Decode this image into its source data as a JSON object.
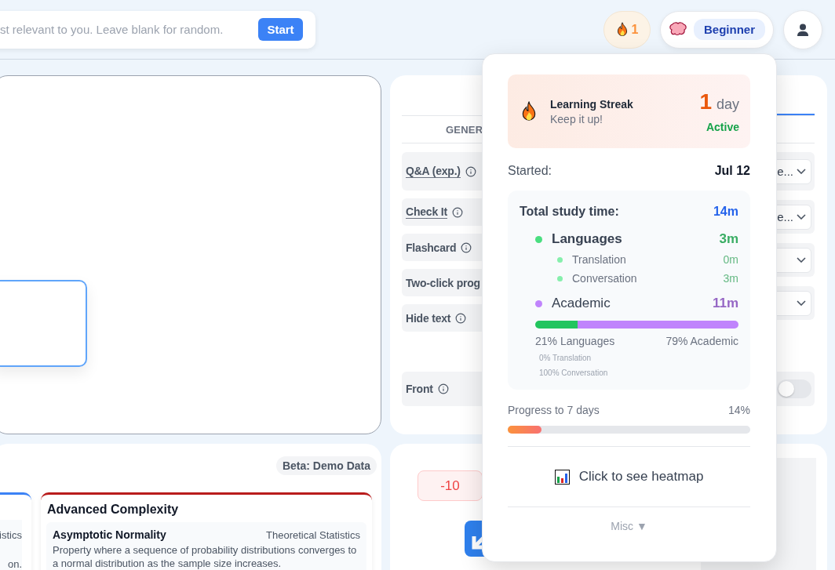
{
  "search": {
    "placeholder": "st relevant to you. Leave blank for random.",
    "button": "Start"
  },
  "header": {
    "streak_count": "1",
    "level": "Beginner"
  },
  "settings": {
    "column_header": "GENER",
    "labels": [
      {
        "label": "Q&A (exp.)",
        "underlined": true,
        "info": true
      },
      {
        "label": "Check It",
        "underlined": true,
        "info": true
      },
      {
        "label": "Flashcard",
        "underlined": false,
        "info": true
      },
      {
        "label": "Two-click prog",
        "underlined": false,
        "info": false
      },
      {
        "label": "Hide text",
        "underlined": false,
        "info": true
      }
    ],
    "controls": [
      {
        "kind": "select",
        "value": "e..."
      },
      {
        "kind": "select",
        "value": "e..."
      },
      {
        "kind": "select"
      },
      {
        "kind": "select"
      }
    ],
    "front": {
      "label": "Front",
      "info": true,
      "on": false
    }
  },
  "concepts": {
    "badge": "Beta: Demo Data",
    "partial_card": {
      "lines": [
        "istics",
        "on."
      ]
    },
    "card": {
      "title": "Advanced Complexity",
      "color": "#b91c1c",
      "item": {
        "name": "Asymptotic Normality",
        "field": "Theoretical Statistics",
        "description": "Property where a sequence of probability distributions converges to a normal distribution as the sample size increases."
      }
    }
  },
  "score": {
    "value": "-10"
  },
  "popover": {
    "streak": {
      "title": "Learning Streak",
      "subtitle": "Keep it up!",
      "count": "1",
      "unit": "day",
      "status": "Active"
    },
    "started": {
      "label": "Started:",
      "value": "Jul 12"
    },
    "study": {
      "title": "Total study time:",
      "total": "14m",
      "categories": [
        {
          "name": "Languages",
          "time": "3m",
          "color": "#4ade80",
          "expanded": true,
          "children": [
            {
              "name": "Translation",
              "time": "0m",
              "color": "#86efac"
            },
            {
              "name": "Conversation",
              "time": "3m",
              "color": "#86efac"
            }
          ]
        },
        {
          "name": "Academic",
          "time": "11m",
          "color": "#c084fc",
          "expanded": false
        }
      ],
      "bar": [
        {
          "label": "21% Languages",
          "level": 0.21,
          "color": "#22c55e"
        },
        {
          "label": "79% Academic",
          "level": 0.79,
          "color": "#c084fc"
        }
      ],
      "sub_breakdown": [
        "0% Translation",
        "100% Conversation"
      ]
    },
    "progress": {
      "label": "Progress to 7 days",
      "reading": "14%",
      "level": 0.14
    },
    "heatmap": "Click to see heatmap",
    "misc": "Misc ▼"
  }
}
